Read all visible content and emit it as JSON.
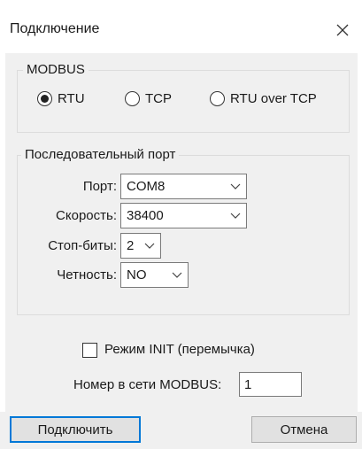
{
  "dialog": {
    "title": "Подключение"
  },
  "modbus": {
    "group_label": "MODBUS",
    "options": [
      {
        "label": "RTU",
        "selected": true
      },
      {
        "label": "TCP",
        "selected": false
      },
      {
        "label": "RTU over TCP",
        "selected": false
      }
    ]
  },
  "serial": {
    "group_label": "Последовательный порт",
    "port_label": "Порт:",
    "port_value": "COM8",
    "speed_label": "Скорость:",
    "speed_value": "38400",
    "stopbits_label": "Стоп-биты:",
    "stopbits_value": "2",
    "parity_label": "Четность:",
    "parity_value": "NO"
  },
  "init": {
    "label": "Режим INIT (перемычка)",
    "checked": false
  },
  "address": {
    "label": "Номер в сети MODBUS:",
    "value": "1"
  },
  "buttons": {
    "connect": "Подключить",
    "cancel": "Отмена"
  },
  "icons": {
    "close": "close-icon",
    "dropdown": "chevron-down-icon"
  },
  "colors": {
    "accent": "#0078d7",
    "panel": "#f0f0f0"
  }
}
